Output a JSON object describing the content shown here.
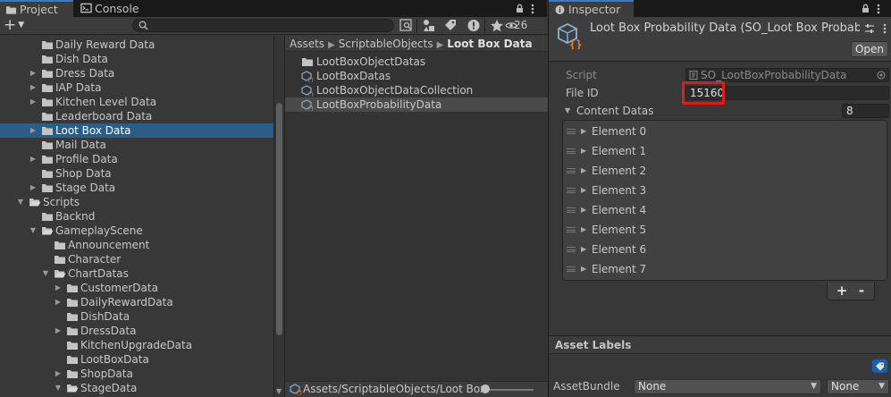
{
  "project_window": {
    "tabs": [
      {
        "label": "Project",
        "icon": "folder-icon"
      },
      {
        "label": "Console",
        "icon": "console-icon"
      }
    ],
    "hidden_count": "26",
    "tree": [
      {
        "label": "Daily Reward Data",
        "depth": 2,
        "arrow": ""
      },
      {
        "label": "Dish Data",
        "depth": 2,
        "arrow": ""
      },
      {
        "label": "Dress Data",
        "depth": 2,
        "arrow": "right"
      },
      {
        "label": "IAP Data",
        "depth": 2,
        "arrow": "right"
      },
      {
        "label": "Kitchen Level Data",
        "depth": 2,
        "arrow": "right"
      },
      {
        "label": "Leaderboard Data",
        "depth": 2,
        "arrow": ""
      },
      {
        "label": "Loot Box Data",
        "depth": 2,
        "arrow": "right",
        "selected": true
      },
      {
        "label": "Mail Data",
        "depth": 2,
        "arrow": ""
      },
      {
        "label": "Profile Data",
        "depth": 2,
        "arrow": "right"
      },
      {
        "label": "Shop Data",
        "depth": 2,
        "arrow": ""
      },
      {
        "label": "Stage Data",
        "depth": 2,
        "arrow": "right"
      },
      {
        "label": "Scripts",
        "depth": 1,
        "arrow": "down",
        "open": true
      },
      {
        "label": "Backnd",
        "depth": 2,
        "arrow": ""
      },
      {
        "label": "GameplayScene",
        "depth": 2,
        "arrow": "down",
        "open": true
      },
      {
        "label": "Announcement",
        "depth": 3,
        "arrow": ""
      },
      {
        "label": "Character",
        "depth": 3,
        "arrow": ""
      },
      {
        "label": "ChartDatas",
        "depth": 3,
        "arrow": "down",
        "open": true
      },
      {
        "label": "CustomerData",
        "depth": 4,
        "arrow": "right"
      },
      {
        "label": "DailyRewardData",
        "depth": 4,
        "arrow": "right"
      },
      {
        "label": "DishData",
        "depth": 4,
        "arrow": ""
      },
      {
        "label": "DressData",
        "depth": 4,
        "arrow": "right"
      },
      {
        "label": "KitchenUpgradeData",
        "depth": 4,
        "arrow": ""
      },
      {
        "label": "LootBoxData",
        "depth": 4,
        "arrow": ""
      },
      {
        "label": "ShopData",
        "depth": 4,
        "arrow": "right"
      },
      {
        "label": "StageData",
        "depth": 4,
        "arrow": "down",
        "open": true
      }
    ],
    "breadcrumb": [
      "Assets",
      "ScriptableObjects",
      "Loot Box Data"
    ],
    "assets": [
      {
        "label": "LootBoxObjectDatas",
        "kind": "folder"
      },
      {
        "label": "LootBoxDatas",
        "kind": "scriptable"
      },
      {
        "label": "LootBoxObjectDataCollection",
        "kind": "scriptable"
      },
      {
        "label": "LootBoxProbabilityData",
        "kind": "scriptable",
        "selected": true
      }
    ],
    "path_bar": "Assets/ScriptableObjects/Loot Box D"
  },
  "inspector": {
    "tab_label": "Inspector",
    "title": "Loot Box Probability Data (SO_Loot Box Probabili",
    "open_label": "Open",
    "script_label": "Script",
    "script_value": "SO_LootBoxProbabilityData",
    "file_id_label": "File ID",
    "file_id_value": "15160",
    "content_label": "Content Datas",
    "content_count": "8",
    "elements": [
      "Element 0",
      "Element 1",
      "Element 2",
      "Element 3",
      "Element 4",
      "Element 5",
      "Element 6",
      "Element 7"
    ],
    "plus_label": "+",
    "minus_label": "-",
    "asset_labels": "Asset Labels",
    "asset_bundle_label": "AssetBundle",
    "bundle_value": "None",
    "variant_value": "None"
  },
  "colors": {
    "selection": "#2c5d87",
    "accent": "#3a79bb",
    "highlight": "#e01919",
    "asset_icon": "#e5822b"
  }
}
